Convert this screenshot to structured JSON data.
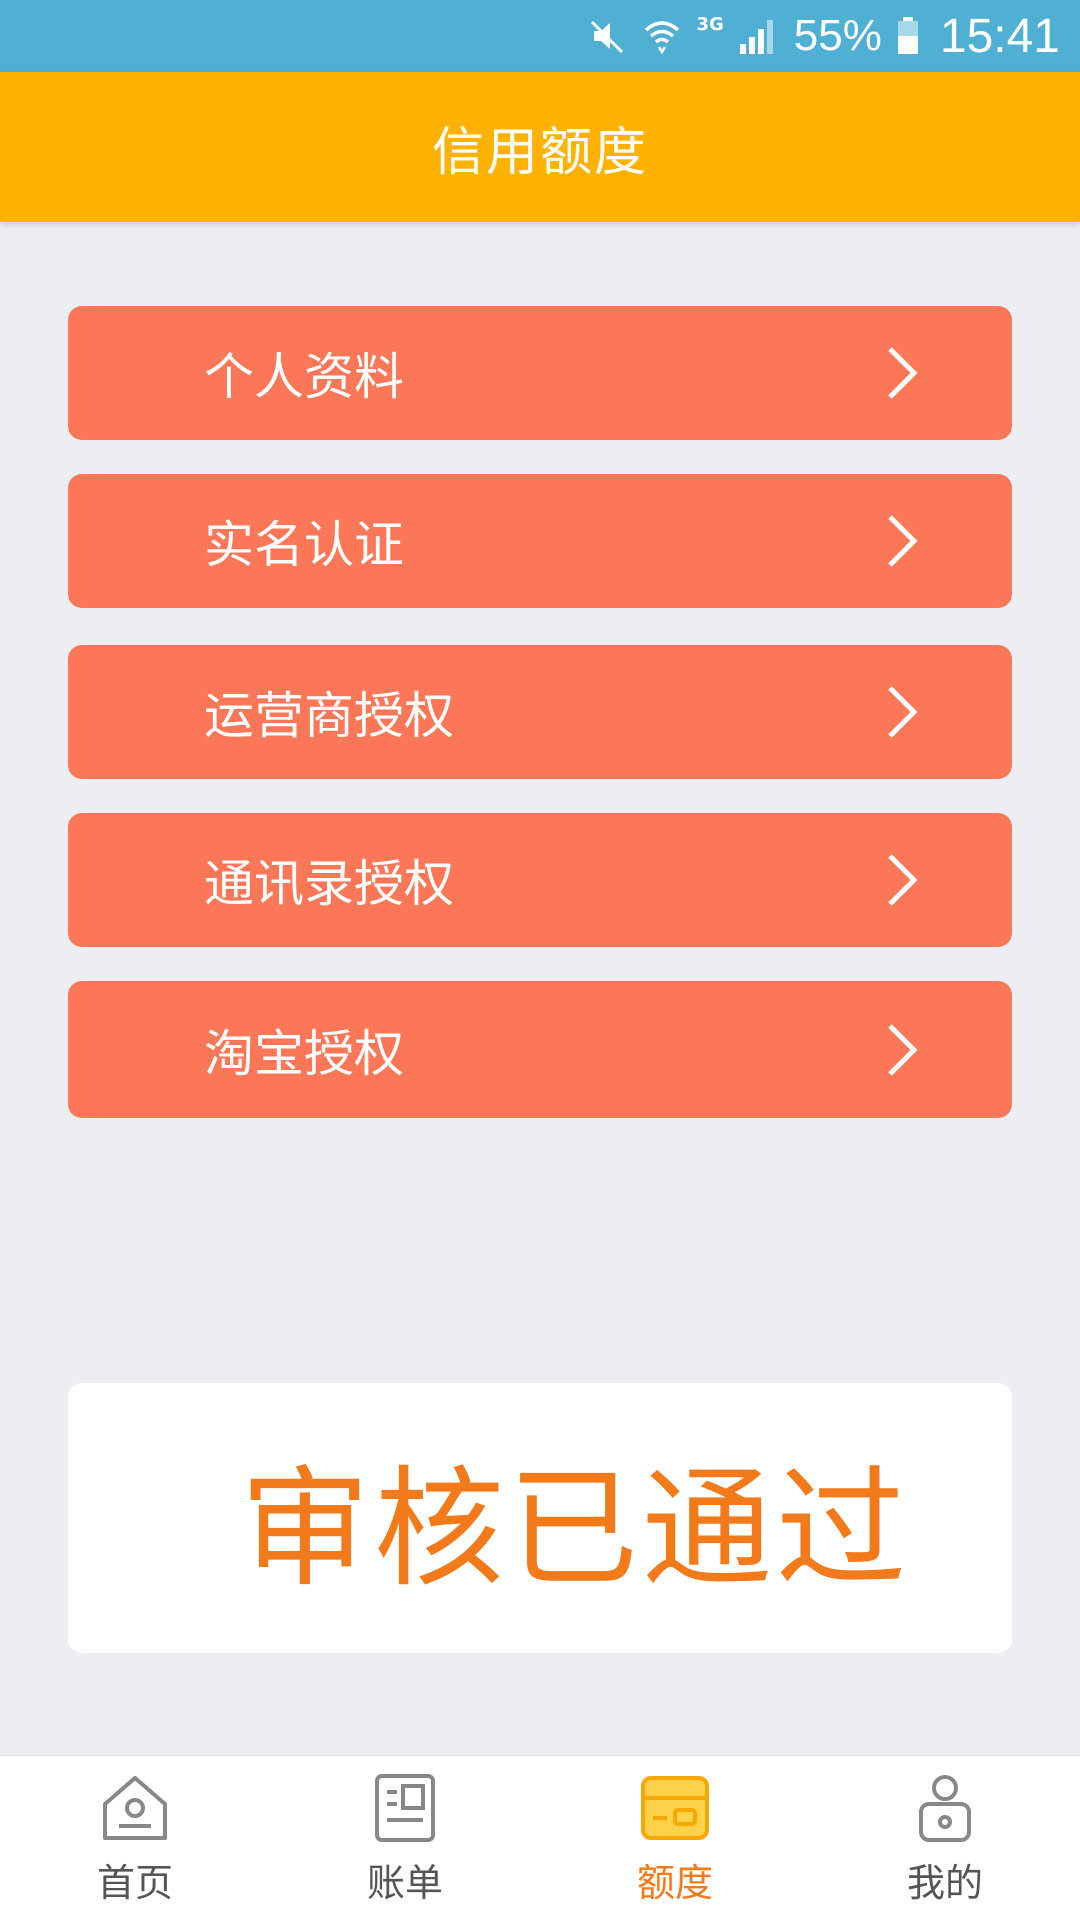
{
  "status_bar": {
    "network": "3G",
    "battery": "55%",
    "time": "15:41",
    "icons": [
      "mute-icon",
      "wifi-icon",
      "signal-icon",
      "battery-icon"
    ]
  },
  "header": {
    "title": "信用额度"
  },
  "menu": {
    "items": [
      {
        "label": "个人资料",
        "icon": "chevron-right-icon"
      },
      {
        "label": "实名认证",
        "icon": "chevron-right-icon"
      },
      {
        "label": "运营商授权",
        "icon": "chevron-right-icon"
      },
      {
        "label": "通讯录授权",
        "icon": "chevron-right-icon"
      },
      {
        "label": "淘宝授权",
        "icon": "chevron-right-icon"
      }
    ]
  },
  "status_card": {
    "text": "审核已通过"
  },
  "bottom_nav": {
    "active": "额度",
    "items": [
      {
        "label": "首页",
        "icon": "home-icon"
      },
      {
        "label": "账单",
        "icon": "bill-icon"
      },
      {
        "label": "额度",
        "icon": "credit-card-icon"
      },
      {
        "label": "我的",
        "icon": "profile-icon"
      }
    ]
  },
  "colors": {
    "status_bar": "#4fb0d4",
    "header": "#ffb300",
    "menu_item": "#fc7757",
    "accent": "#f37a1a",
    "background": "#eceef2"
  }
}
